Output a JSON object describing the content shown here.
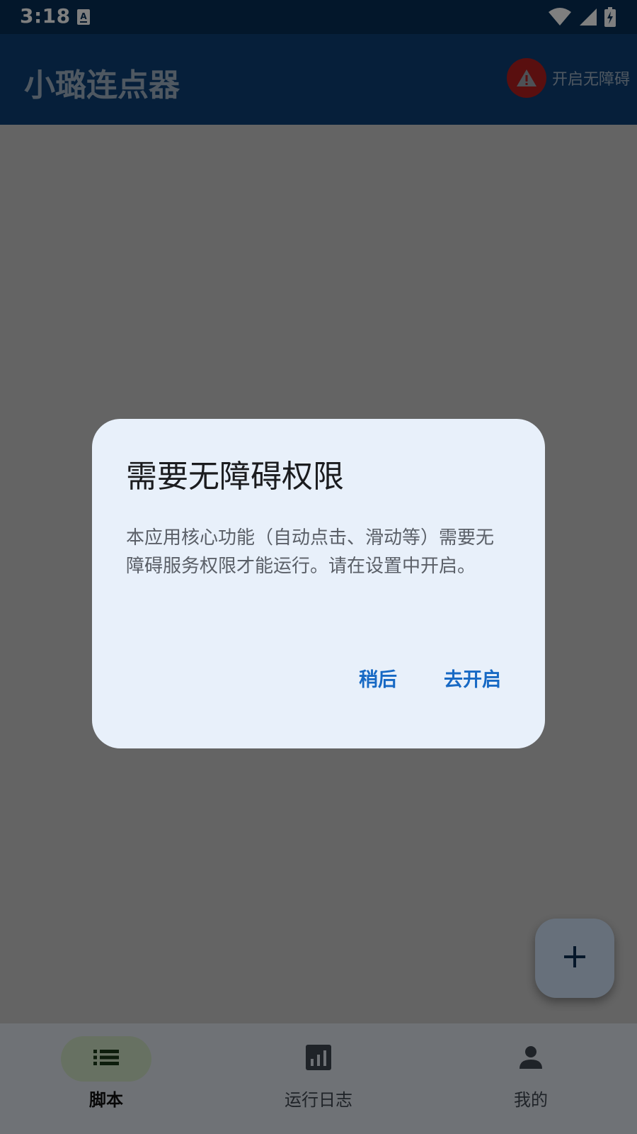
{
  "status_bar": {
    "time": "3:18",
    "icons": [
      "accessibility-notification-icon",
      "wifi-icon",
      "cellular-signal-icon",
      "battery-charging-icon"
    ]
  },
  "app_bar": {
    "title": "小璐连点器",
    "accessibility_action_label": "开启无障碍",
    "accessibility_action_icon": "warning-icon"
  },
  "fab": {
    "icon": "plus-icon"
  },
  "bottom_nav": {
    "items": [
      {
        "label": "脚本",
        "icon": "list-icon",
        "active": true
      },
      {
        "label": "运行日志",
        "icon": "bar-chart-icon",
        "active": false
      },
      {
        "label": "我的",
        "icon": "person-icon",
        "active": false
      }
    ]
  },
  "dialog": {
    "title": "需要无障碍权限",
    "body": "本应用核心功能（自动点击、滑动等）需要无障碍服务权限才能运行。请在设置中开启。",
    "later_label": "稍后",
    "enable_label": "去开启"
  },
  "colors": {
    "status_bar_bg": "#062f57",
    "app_bar_bg": "#0c3f75",
    "warning_red": "#b21f1f",
    "dialog_bg": "#e8f0fa",
    "dialog_button": "#1769c4",
    "nav_active_pill": "#cfe3c4",
    "fab_bg": "#cfe1f7"
  }
}
